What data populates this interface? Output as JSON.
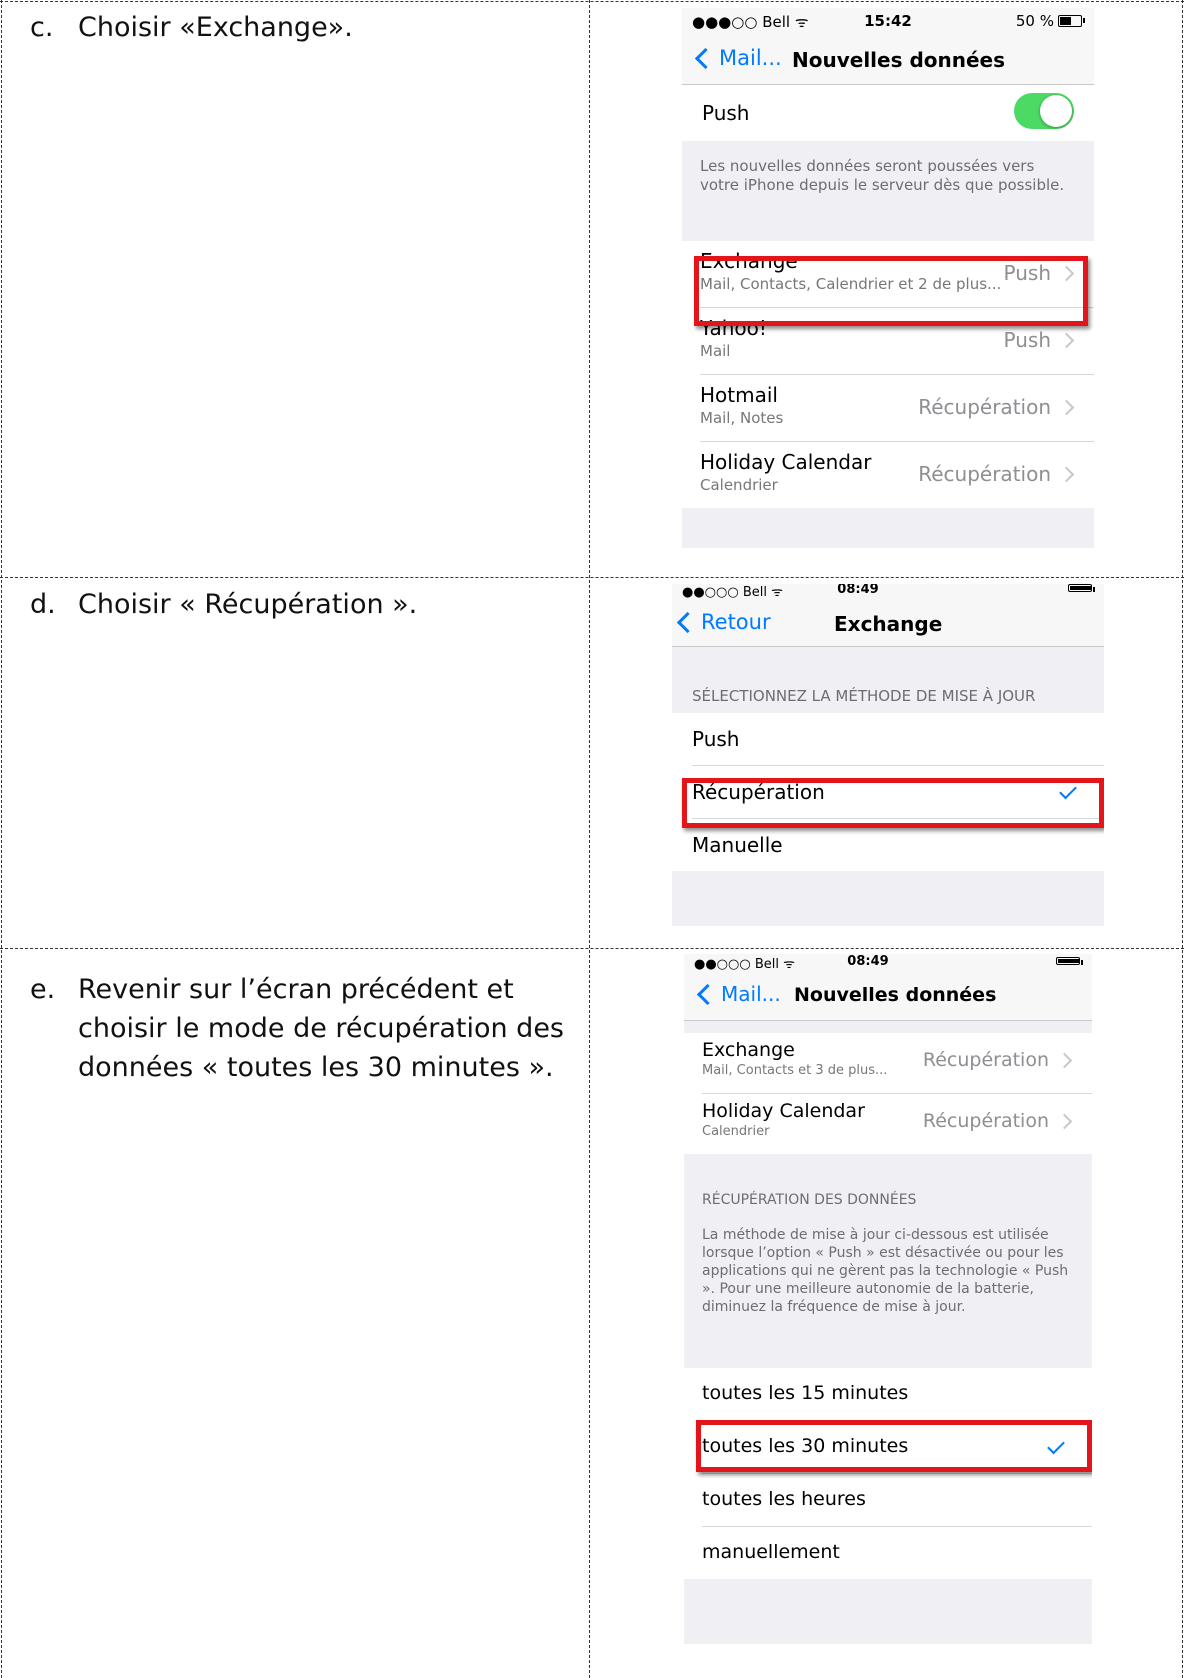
{
  "steps": [
    {
      "letter": "c.",
      "text": "Choisir «Exchange»."
    },
    {
      "letter": "d.",
      "text": "Choisir « Récupération »."
    },
    {
      "letter": "e.",
      "text": "Revenir sur l’écran précédent et choisir le mode de récupération des données « toutes les 30 minutes »."
    }
  ],
  "screen1": {
    "status": {
      "carrier": "●●●○○ Bell ᯤ",
      "time": "15:42",
      "battery": "50 %"
    },
    "nav": {
      "back": "Mail...",
      "title": "Nouvelles données"
    },
    "push": {
      "label": "Push",
      "on": true
    },
    "footer": "Les nouvelles données seront poussées vers votre iPhone depuis le serveur dès que possible.",
    "accounts": [
      {
        "name": "Exchange",
        "sub": "Mail, Contacts, Calendrier et 2 de plus...",
        "value": "Push"
      },
      {
        "name": "Yahoo!",
        "sub": "Mail",
        "value": "Push"
      },
      {
        "name": "Hotmail",
        "sub": "Mail, Notes",
        "value": "Récupération"
      },
      {
        "name": "Holiday Calendar",
        "sub": "Calendrier",
        "value": "Récupération"
      }
    ]
  },
  "screen2": {
    "status": {
      "carrier": "●●○○○ Bell ᯤ",
      "time": "08:49"
    },
    "nav": {
      "back": "Retour",
      "title": "Exchange"
    },
    "section_header": "SÉLECTIONNEZ LA MÉTHODE DE MISE À JOUR",
    "options": [
      "Push",
      "Récupération",
      "Manuelle"
    ],
    "selected_index": 1
  },
  "screen3": {
    "status": {
      "carrier": "●●○○○ Bell ᯤ",
      "time": "08:49"
    },
    "nav": {
      "back": "Mail...",
      "title": "Nouvelles données"
    },
    "accounts": [
      {
        "name": "Exchange",
        "sub": "Mail, Contacts et 3 de plus...",
        "value": "Récupération"
      },
      {
        "name": "Holiday Calendar",
        "sub": "Calendrier",
        "value": "Récupération"
      }
    ],
    "section_header": "RÉCUPÉRATION DES DONNÉES",
    "footer": "La méthode de mise à jour ci-dessous est utilisée lorsque l’option « Push » est désactivée ou pour les applications qui ne gèrent pas la technologie « Push ». Pour une meilleure autonomie de la batterie, diminuez la fréquence de mise à jour.",
    "intervals": [
      "toutes les 15 minutes",
      "toutes les 30 minutes",
      "toutes les heures",
      "manuellement"
    ],
    "selected_index": 1
  },
  "colors": {
    "highlight": "#e4141b",
    "ios_blue": "#007aff",
    "toggle_on": "#4cd964"
  }
}
